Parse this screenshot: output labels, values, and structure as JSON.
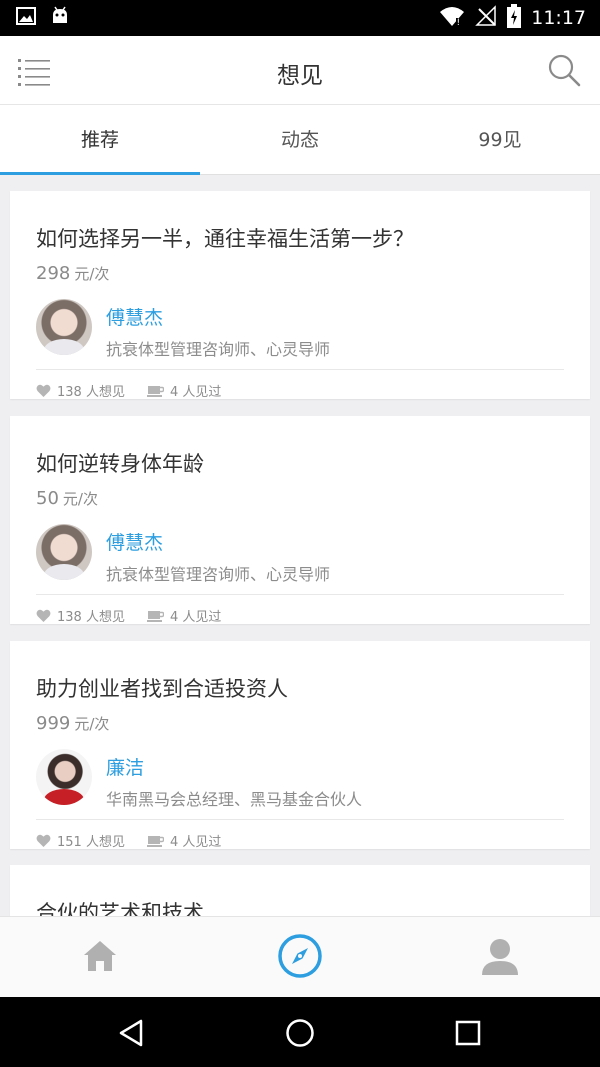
{
  "status_bar": {
    "time": "11:17",
    "left_icons": [
      "image-notification-icon",
      "android-notification-icon"
    ],
    "right_icons": [
      "wifi-icon",
      "no-signal-icon",
      "battery-charging-icon"
    ]
  },
  "header": {
    "title": "想见",
    "menu_icon": "list-menu-icon",
    "search_icon": "search-icon"
  },
  "tabs": [
    {
      "label": "推荐",
      "active": true
    },
    {
      "label": "动态",
      "active": false
    },
    {
      "label": "99见",
      "active": false
    }
  ],
  "cards": [
    {
      "title": "如何选择另一半，通往幸福生活第一步？",
      "price": "298",
      "price_unit": "元/次",
      "host_name": "傅慧杰",
      "host_title": "抗衰体型管理咨询师、心灵导师",
      "likes_text": "138 人想见",
      "met_text": "4 人见过"
    },
    {
      "title": "如何逆转身体年龄",
      "price": "50",
      "price_unit": "元/次",
      "host_name": "傅慧杰",
      "host_title": "抗衰体型管理咨询师、心灵导师",
      "likes_text": "138 人想见",
      "met_text": "4 人见过"
    },
    {
      "title": "助力创业者找到合适投资人",
      "price": "999",
      "price_unit": "元/次",
      "host_name": "廉洁",
      "host_title": "华南黑马会总经理、黑马基金合伙人",
      "likes_text": "151 人想见",
      "met_text": "4 人见过"
    },
    {
      "title": "合伙的艺术和技术"
    }
  ],
  "bottom_nav": [
    {
      "icon": "home-icon",
      "active": false
    },
    {
      "icon": "compass-icon",
      "active": true
    },
    {
      "icon": "profile-icon",
      "active": false
    }
  ],
  "system_nav": [
    "back-icon",
    "home-circle-icon",
    "recents-icon"
  ],
  "colors": {
    "accent": "#2d9ee0",
    "text_primary": "#333333",
    "text_secondary": "#8c8c8c",
    "background": "#efeff1"
  }
}
